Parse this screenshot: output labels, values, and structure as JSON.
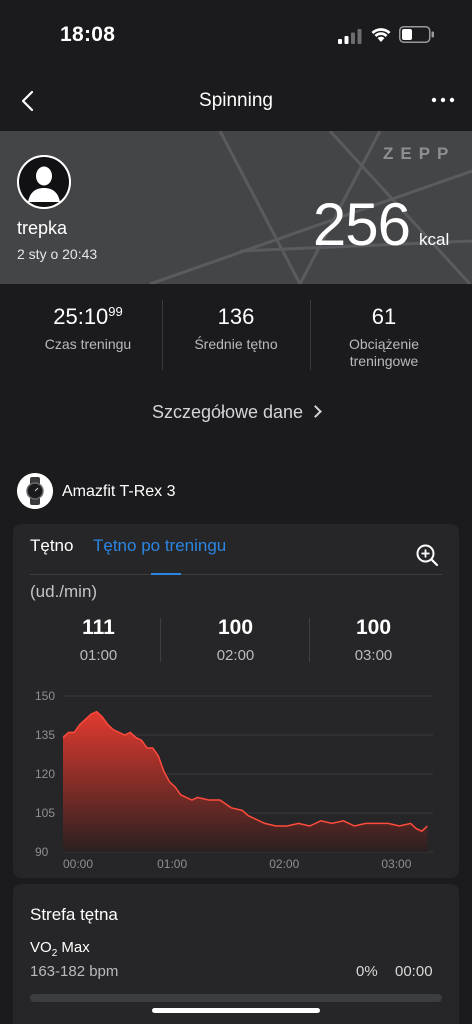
{
  "status_bar": {
    "time": "18:08"
  },
  "nav": {
    "title": "Spinning"
  },
  "hero": {
    "brand": "ZEPP",
    "username": "trepka",
    "date": "2 sty o 20:43",
    "calories": "256",
    "calories_unit": "kcal"
  },
  "stats": [
    {
      "value": "25:10",
      "sup": "99",
      "label": "Czas treningu"
    },
    {
      "value": "136",
      "label": "Średnie tętno"
    },
    {
      "value": "61",
      "label": "Obciążenie treningowe"
    }
  ],
  "details_link": "Szczegółowe dane",
  "device": {
    "name": "Amazfit T-Rex 3"
  },
  "hr_card": {
    "tabs": {
      "heart_rate": "Tętno",
      "post_workout": "Tętno po treningu"
    },
    "unit": "(ud./min)",
    "summary": [
      {
        "value": "111",
        "time": "01:00"
      },
      {
        "value": "100",
        "time": "02:00"
      },
      {
        "value": "100",
        "time": "03:00"
      }
    ]
  },
  "chart_data": {
    "type": "area",
    "title": "",
    "xlabel": "",
    "ylabel": "(ud./min)",
    "ylim": [
      90,
      150
    ],
    "xlim": [
      0,
      3.3
    ],
    "y_ticks": [
      "150",
      "135",
      "120",
      "105",
      "90"
    ],
    "x_ticks": [
      "00:00",
      "01:00",
      "02:00",
      "03:00"
    ],
    "series": [
      {
        "x": [
          0,
          0.05,
          0.1,
          0.15,
          0.2,
          0.25,
          0.3,
          0.35,
          0.4,
          0.45,
          0.5,
          0.55,
          0.6,
          0.65,
          0.7,
          0.75,
          0.8,
          0.85,
          0.9,
          0.95,
          1.0,
          1.05,
          1.1,
          1.15,
          1.2,
          1.3,
          1.4,
          1.5,
          1.6,
          1.65,
          1.7,
          1.8,
          1.9,
          2.0,
          2.1,
          2.2,
          2.3,
          2.4,
          2.5,
          2.6,
          2.7,
          2.8,
          2.9,
          3.0,
          3.1,
          3.15,
          3.2,
          3.25
        ],
        "y": [
          134,
          136,
          136,
          139,
          141,
          143,
          144,
          142,
          139,
          137,
          136,
          135,
          136,
          134,
          133,
          130,
          130,
          127,
          121,
          117,
          115,
          112,
          111,
          110,
          111,
          110,
          110,
          107,
          106,
          104,
          103,
          101,
          100,
          100,
          101,
          100,
          102,
          101,
          102,
          100,
          101,
          101,
          101,
          100,
          101,
          99,
          98,
          100
        ]
      }
    ],
    "color_top": "#e23a2f",
    "color_bottom": "#2a2020"
  },
  "zone_card": {
    "title": "Strefa tętna",
    "zone_name": "VO",
    "zone_name_sub": "2",
    "zone_name_rest": " Max",
    "range": "163-182 bpm",
    "percent": "0%",
    "duration": "00:00",
    "fill_fraction": 0
  }
}
